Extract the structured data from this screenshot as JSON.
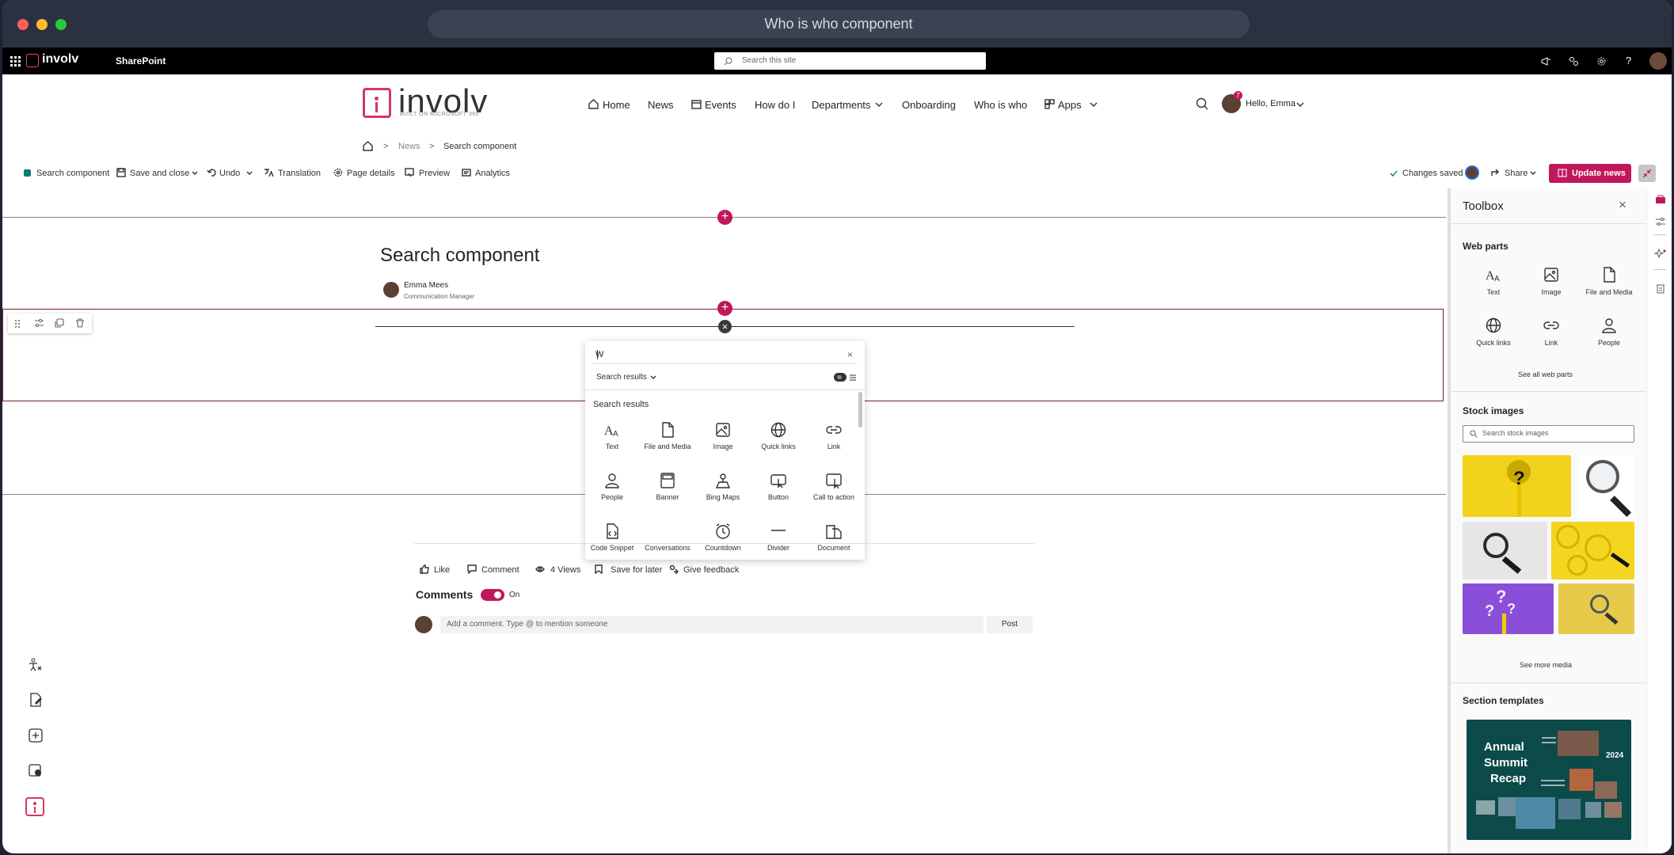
{
  "window": {
    "title": "Who is who component"
  },
  "sp_bar": {
    "brand": "involv",
    "app": "SharePoint",
    "search_placeholder": "Search this site"
  },
  "site_header": {
    "logo_text": "involv",
    "logo_sub": "BUILT ON MICROSOFT 365",
    "nav": [
      "Home",
      "News",
      "Events",
      "How do I",
      "Departments",
      "Onboarding",
      "Who is who",
      "Apps"
    ],
    "greeting": "Hello, Emma",
    "notification_count": "7"
  },
  "breadcrumb": {
    "items": [
      "News",
      "Search component"
    ]
  },
  "command_bar": {
    "page_name": "Search component",
    "save_close": "Save and close",
    "undo": "Undo",
    "translation": "Translation",
    "page_details": "Page details",
    "preview": "Preview",
    "analytics": "Analytics",
    "status": "Changes saved",
    "share": "Share",
    "update": "Update news"
  },
  "page": {
    "title": "Search component",
    "author_name": "Emma Mees",
    "author_role": "Communication Manager"
  },
  "webpart_picker": {
    "query": "W",
    "filter_label": "Search results",
    "section_title": "Search results",
    "items": [
      "Text",
      "File and Media",
      "Image",
      "Quick links",
      "Link",
      "People",
      "Banner",
      "Bing Maps",
      "Button",
      "Call to action",
      "Code Snippet",
      "Conversations",
      "Countdown",
      "Divider",
      "Document"
    ]
  },
  "social": {
    "like": "Like",
    "comment": "Comment",
    "views": "4 Views",
    "save_later": "Save for later",
    "feedback": "Give feedback",
    "comments_title": "Comments",
    "comments_toggle": "On",
    "comment_placeholder": "Add a comment. Type @ to mention someone",
    "post": "Post"
  },
  "toolbox": {
    "title": "Toolbox",
    "web_parts_title": "Web parts",
    "web_parts": [
      "Text",
      "Image",
      "File and Media",
      "Quick links",
      "Link",
      "People"
    ],
    "see_all": "See all web parts",
    "stock_title": "Stock images",
    "stock_placeholder": "Search stock images",
    "see_more": "See more media",
    "templates_title": "Section templates",
    "template_card": {
      "line1": "Annual",
      "line2": "Summit",
      "line3": "Recap",
      "year": "2024"
    }
  },
  "colors": {
    "accent": "#c0185c",
    "titlebar": "#2b3140"
  }
}
